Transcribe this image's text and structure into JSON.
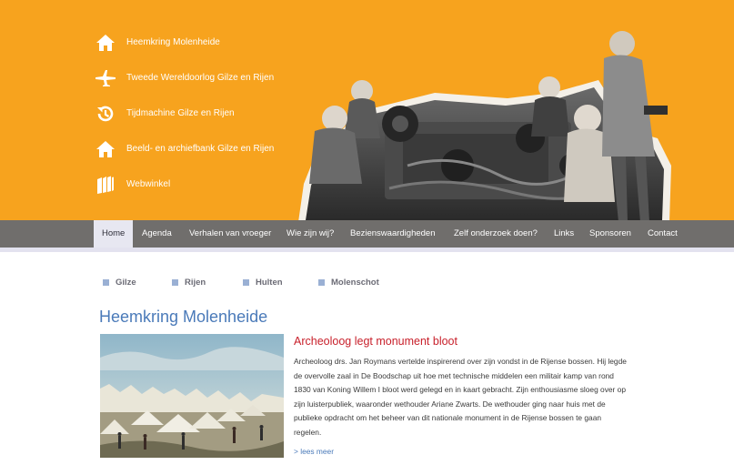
{
  "header": {
    "links": [
      {
        "label": "Heemkring Molenheide",
        "icon": "home-icon"
      },
      {
        "label": "Tweede Wereldoorlog Gilze en Rijen",
        "icon": "airplane-icon"
      },
      {
        "label": "Tijdmachine Gilze en Rijen",
        "icon": "history-icon"
      },
      {
        "label": "Beeld- en archiefbank Gilze en Rijen",
        "icon": "home-icon"
      },
      {
        "label": "Webwinkel",
        "icon": "books-icon"
      }
    ],
    "photo": "historic-workshop-photo"
  },
  "nav": {
    "items": [
      "Home",
      "Agenda",
      "Verhalen van vroeger",
      "Wie zijn wij?",
      "Bezienswaardigheden",
      "Zelf onderzoek doen?",
      "Links",
      "Sponsoren",
      "Contact"
    ],
    "active": "Home"
  },
  "places": [
    "Gilze",
    "Rijen",
    "Hulten",
    "Molenschot"
  ],
  "page_title": "Heemkring Molenheide",
  "article": {
    "image": "historic-army-camp-painting",
    "title": "Archeoloog legt monument bloot",
    "body_lines": [
      "Archeoloog drs. Jan Roymans vertelde inspirerend over zijn vondst in de Rijense bossen. Hij legde",
      "de overvolle zaal in De Boodschap uit hoe met technische middelen een militair kamp van rond",
      "1830 van Koning Willem I bloot werd gelegd en in kaart gebracht. Zijn enthousiasme sloeg over op",
      "zijn luisterpubliek, waaronder wethouder Ariane Zwarts. De wethouder ging naar huis met de",
      "publieke opdracht om het beheer van dit nationale monument in de Rijense bossen te gaan",
      "regelen."
    ],
    "read_more": "> lees meer"
  },
  "colors": {
    "header_bg": "#f7a31e",
    "nav_bg": "#706e6c",
    "title_blue": "#4a7ab9",
    "article_red": "#c8202b",
    "bullet_blue": "#9ab0d4"
  }
}
